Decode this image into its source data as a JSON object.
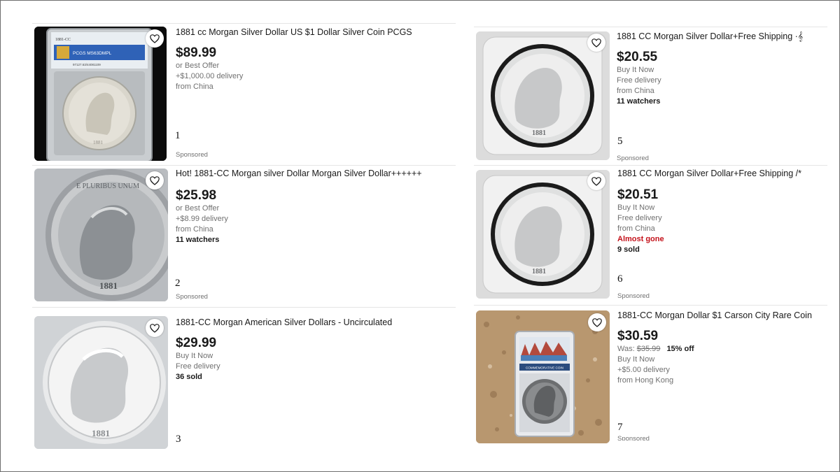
{
  "listings": [
    {
      "number": "1",
      "title": "1881 cc Morgan Silver Dollar US $1 Dollar Silver Coin PCGS",
      "price": "$89.99",
      "lines": [
        "or Best Offer",
        "+$1,000.00 delivery",
        "from China"
      ],
      "sponsored": "Sponsored",
      "image": "slabbed-coin-pcgs"
    },
    {
      "number": "2",
      "title": "Hot! 1881-CC Morgan silver Dollar Morgan Silver Dollar++++++",
      "price": "$25.98",
      "lines": [
        "or Best Offer",
        "+$8.99 delivery",
        "from China"
      ],
      "watchers": "11 watchers",
      "sponsored": "Sponsored",
      "image": "coin-closeup"
    },
    {
      "number": "3",
      "title": "1881-CC Morgan American Silver Dollars - Uncirculated",
      "price": "$29.99",
      "lines": [
        "Buy It Now",
        "Free delivery"
      ],
      "sold": "36 sold",
      "image": "coin-bright"
    },
    {
      "number": "5",
      "title": "1881 CC Morgan Silver Dollar+Free Shipping ·𝄞",
      "price": "$20.55",
      "lines": [
        "Buy It Now",
        "Free delivery",
        "from China"
      ],
      "watchers": "11 watchers",
      "sponsored": "Sponsored",
      "image": "coin-in-holder"
    },
    {
      "number": "6",
      "title": "1881 CC Morgan Silver Dollar+Free Shipping /*",
      "price": "$20.51",
      "lines": [
        "Buy It Now",
        "Free delivery",
        "from China"
      ],
      "alert": "Almost gone",
      "sold": "9 sold",
      "sponsored": "Sponsored",
      "image": "coin-in-holder"
    },
    {
      "number": "7",
      "title": "1881-CC Morgan Dollar $1 Carson City Rare Coin",
      "price": "$30.59",
      "was_label": "Was:",
      "was_price": "$35.99",
      "discount": "15% off",
      "lines": [
        "Buy It Now",
        "+$5.00 delivery",
        "from Hong Kong"
      ],
      "sponsored": "Sponsored",
      "slab_label": "COMMEMORATIVE COIN",
      "image": "commemorative-slab"
    }
  ],
  "slab_1": {
    "top_label": "1881-CC",
    "grade_label": "PCGS MS63DMPL",
    "cert": "97127.63/44081109"
  },
  "coin_text": {
    "legend": "E PLURIBUS UNUM",
    "year": "1881"
  },
  "colors": {
    "price": "#191919",
    "muted": "#707070",
    "alert": "#c4121b",
    "heart_bg": "#ffffff"
  }
}
